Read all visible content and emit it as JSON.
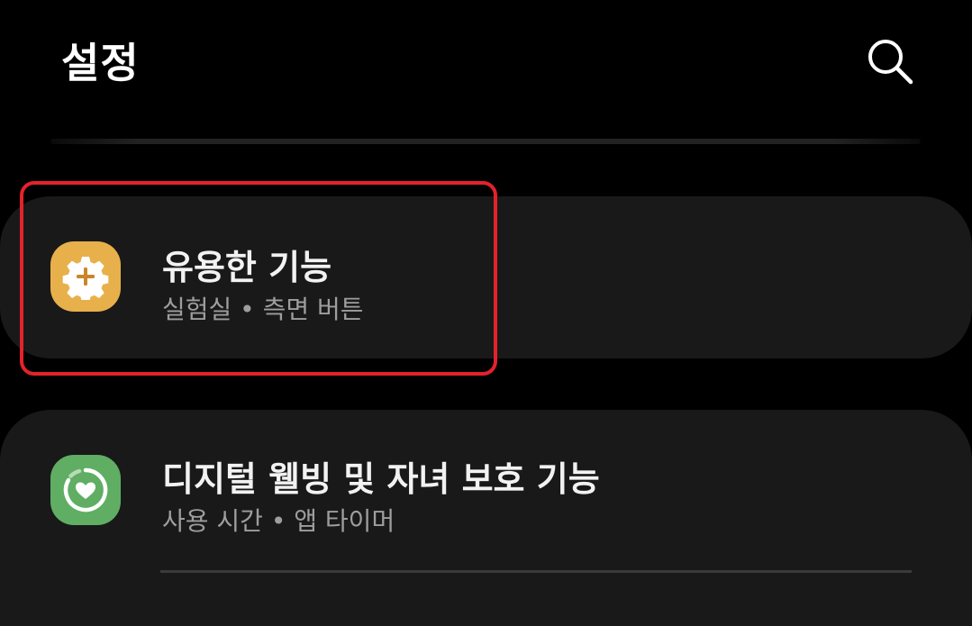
{
  "header": {
    "title": "설정",
    "search_icon": "search-icon"
  },
  "items": [
    {
      "title": "유용한 기능",
      "subtitle": "실험실  •  측면 버튼",
      "icon": "gear-plus-icon",
      "icon_color": "#E8B04A"
    },
    {
      "title": "디지털 웰빙 및 자녀 보호 기능",
      "subtitle": "사용 시간  •  앱 타이머",
      "icon": "heart-ring-icon",
      "icon_color": "#5FAE63"
    }
  ],
  "highlight_color": "#E3222C"
}
